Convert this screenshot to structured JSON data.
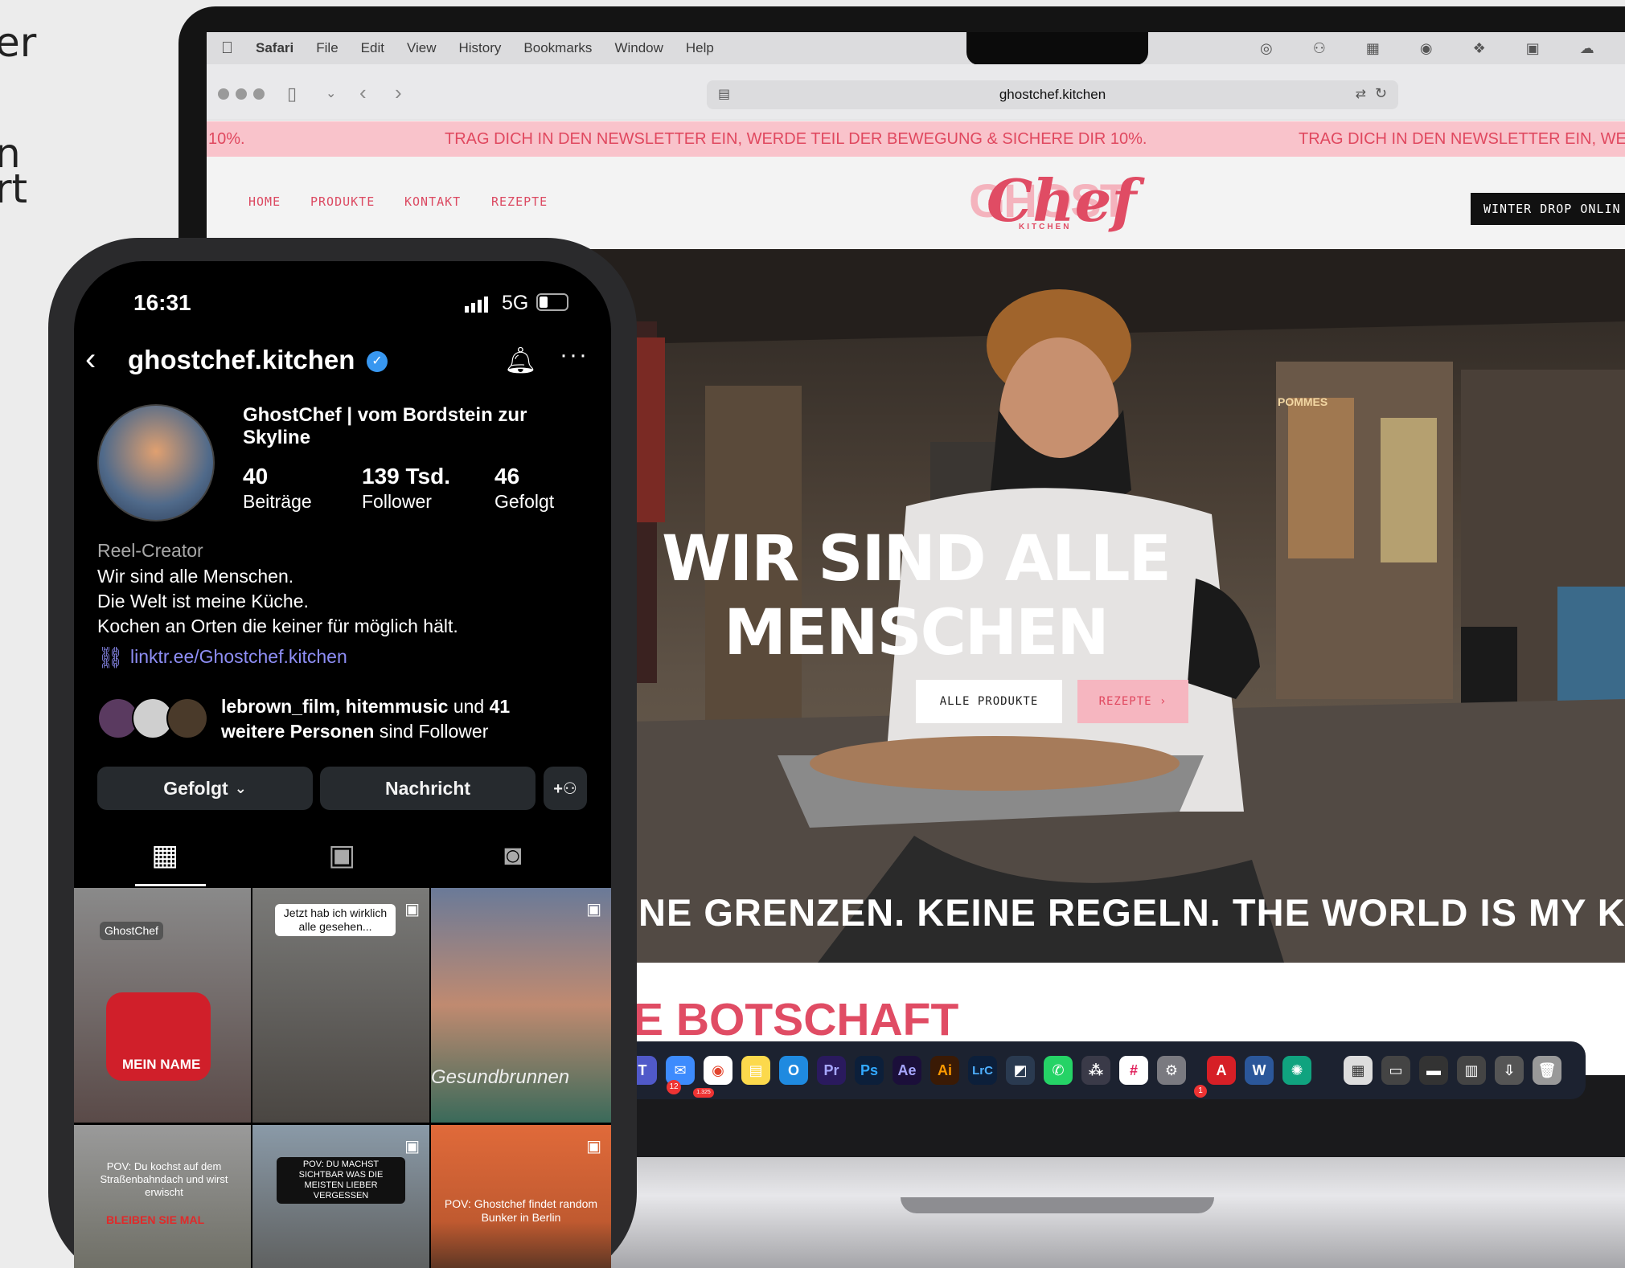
{
  "left_fragments": [
    "er",
    "n",
    "rt"
  ],
  "mac": {
    "menubar": {
      "app": "Safari",
      "items": [
        "File",
        "Edit",
        "View",
        "History",
        "Bookmarks",
        "Window",
        "Help"
      ]
    },
    "url": "ghostchef.kitchen",
    "banner": {
      "left_text": "10%.",
      "mid_text": "TRAG DICH IN DEN NEWSLETTER EIN, WERDE TEIL DER BEWEGUNG & SICHERE DIR 10%.",
      "right_text": "TRAG DICH IN DEN NEWSLETTER EIN, WERD"
    },
    "nav": {
      "items": [
        "HOME",
        "PRODUKTE",
        "KONTAKT",
        "REZEPTE"
      ],
      "cta": "WINTER DROP ONLIN"
    },
    "logo": {
      "word": "Chef",
      "back": "GHOST",
      "sub": "KITCHEN"
    },
    "hero": {
      "headline_1": "WIR SIND ALLE",
      "headline_2": "MENSCHEN",
      "btn_products": "ALLE PRODUKTE",
      "btn_recipes": "REZEPTE ›",
      "ticker": "NE GRENZEN. KEINE REGELN. THE WORLD IS MY KIT",
      "sign_pommes": "POMMES"
    },
    "section_title": "E BOTSCHAFT",
    "dock": {
      "badges": [
        "12",
        "1.325",
        "1"
      ],
      "apps": [
        "Teams",
        "Mail",
        "Chrome",
        "Notes",
        "Outlook",
        "Pr",
        "Ps",
        "Ae",
        "Ai",
        "LrC",
        "Finder",
        "WhatsApp",
        "DaVinci",
        "Slack",
        "Settings",
        "Acrobat",
        "Word",
        "ChatGPT",
        "Preview",
        "Desktop",
        "Folder",
        "Files",
        "Downloads",
        "Trash"
      ]
    }
  },
  "phone": {
    "status": {
      "time": "16:31",
      "network": "5G"
    },
    "profile": {
      "username": "ghostchef.kitchen",
      "name": "GhostChef | vom Bordstein zur Skyline",
      "stats": [
        {
          "value": "40",
          "label": "Beiträge"
        },
        {
          "value": "139 Tsd.",
          "label": "Follower"
        },
        {
          "value": "46",
          "label": "Gefolgt"
        }
      ],
      "category": "Reel-Creator",
      "bio": [
        "Wir sind alle Menschen.",
        "Die Welt ist meine Küche.",
        "Kochen an Orten die keiner für möglich hält."
      ],
      "link": "linktr.ee/Ghostchef.kitchen",
      "followed_by_names": "lebrown_film, hitemmusic",
      "followed_by_und": "und",
      "followed_by_count": "41",
      "followed_by_line2_bold": "weitere Personen",
      "followed_by_line2": "sind Follower"
    },
    "buttons": {
      "following": "Gefolgt",
      "message": "Nachricht"
    },
    "posts": [
      {
        "caption": "GhostChef",
        "overlay": "MEIN NAME"
      },
      {
        "caption": "Jetzt hab ich wirklich alle gesehen..."
      },
      {
        "overlay": "Gesundbrunnen"
      },
      {
        "caption": "POV: Du kochst auf dem Straßenbahndach und wirst erwischt",
        "overlay": "BLEIBEN SIE MAL"
      },
      {
        "caption": "POV: DU MACHST SICHTBAR WAS DIE MEISTEN LIEBER VERGESSEN"
      },
      {
        "caption": "POV: Ghostchef findet random Bunker in Berlin"
      }
    ]
  }
}
